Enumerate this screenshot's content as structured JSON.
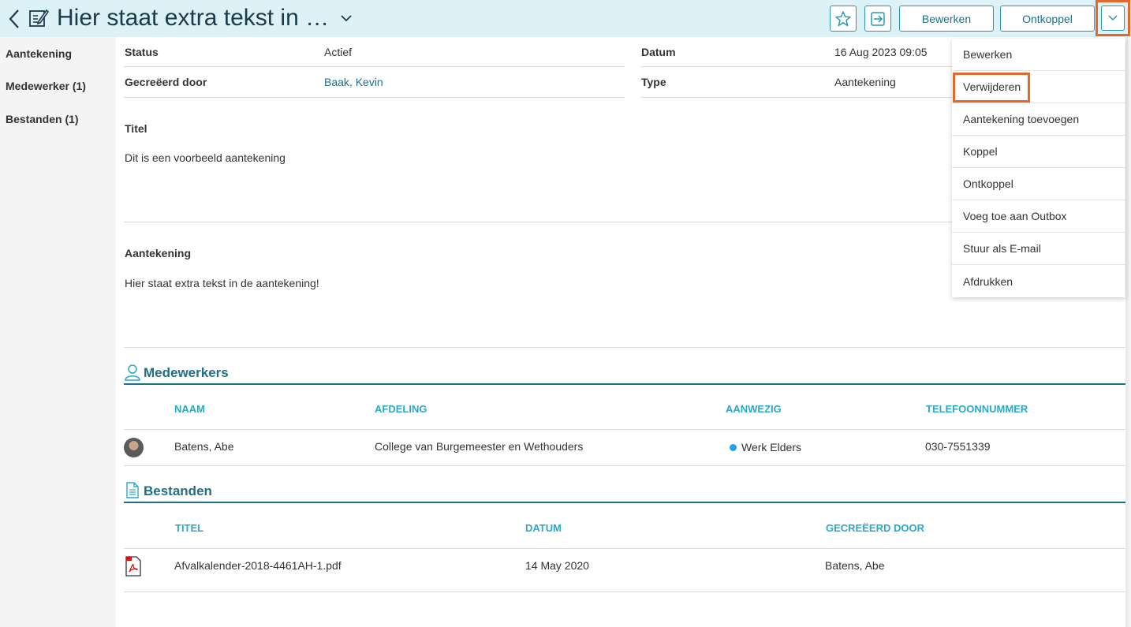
{
  "header": {
    "title": "Hier staat extra tekst in …",
    "edit_label": "Bewerken",
    "unlink_label": "Ontkoppel",
    "icons": [
      "back-icon",
      "edit-note-icon",
      "chevron-down-icon",
      "star-icon",
      "sign-in-icon"
    ]
  },
  "left_nav": {
    "items": [
      {
        "label": "Aantekening"
      },
      {
        "label": "Medewerker (1)"
      },
      {
        "label": "Bestanden (1)"
      }
    ]
  },
  "details": {
    "status_label": "Status",
    "status_value": "Actief",
    "created_by_label": "Gecreëerd door",
    "created_by_value": "Baak, Kevin",
    "date_label": "Datum",
    "date_value": "16 Aug 2023 09:05",
    "type_label": "Type",
    "type_value": "Aantekening"
  },
  "title_section": {
    "label": "Titel",
    "text": "Dit is een voorbeeld aantekening"
  },
  "note_section": {
    "label": "Aantekening",
    "text": "Hier staat extra tekst in de aantekening!"
  },
  "employees": {
    "heading": "Medewerkers",
    "columns": [
      "NAAM",
      "AFDELING",
      "AANWEZIG",
      "TELEFOONNUMMER"
    ],
    "rows": [
      {
        "name": "Batens, Abe",
        "department": "College van Burgemeester en Wethouders",
        "presence": "Werk Elders",
        "phone": "030-7551339"
      }
    ]
  },
  "files": {
    "heading": "Bestanden",
    "columns": [
      "TITEL",
      "DATUM",
      "GECREËERD DOOR"
    ],
    "rows": [
      {
        "title": "Afvalkalender-2018-4461AH-1.pdf",
        "date": "14 May 2020",
        "created_by": "Batens, Abe"
      }
    ]
  },
  "menu": {
    "items": [
      {
        "label": "Bewerken"
      },
      {
        "label": "Verwijderen"
      },
      {
        "label": "Aantekening toevoegen"
      },
      {
        "label": "Koppel"
      },
      {
        "label": "Ontkoppel"
      },
      {
        "label": "Voeg toe aan Outbox"
      },
      {
        "label": "Stuur als E-mail"
      },
      {
        "label": "Afdrukken"
      }
    ]
  },
  "colors": {
    "header_bg": "#ddf2f6",
    "accent": "#1e6f86",
    "column_head": "#2aa9c9",
    "highlight": "#e2692b",
    "presence_dot": "#1aa3e8"
  }
}
